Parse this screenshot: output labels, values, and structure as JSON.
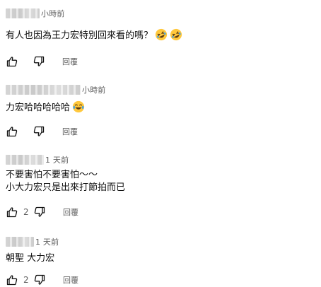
{
  "comments": [
    {
      "time": "小時前",
      "lines": [
        "有人也因為王力宏特別回來看的嗎？"
      ],
      "emojis": [
        "rolling-on-floor-laughing",
        "rolling-on-floor-laughing"
      ],
      "like_count": "",
      "reply_label": "回覆"
    },
    {
      "time": "小時前",
      "lines": [
        "力宏哈哈哈哈哈"
      ],
      "emojis": [
        "tears-of-joy"
      ],
      "like_count": "",
      "reply_label": "回覆"
    },
    {
      "time": "1 天前",
      "lines": [
        "不要害怕不要害怕～～",
        "小大力宏只是出來打節拍而已"
      ],
      "emojis": [],
      "like_count": "2",
      "reply_label": "回覆"
    },
    {
      "time": "1 天前",
      "lines": [
        "朝聖 大力宏"
      ],
      "emojis": [],
      "like_count": "2",
      "reply_label": "回覆"
    }
  ],
  "colors": {
    "text": "#0f0f0f",
    "meta": "#606060",
    "emoji_face": "#ffc83d"
  }
}
